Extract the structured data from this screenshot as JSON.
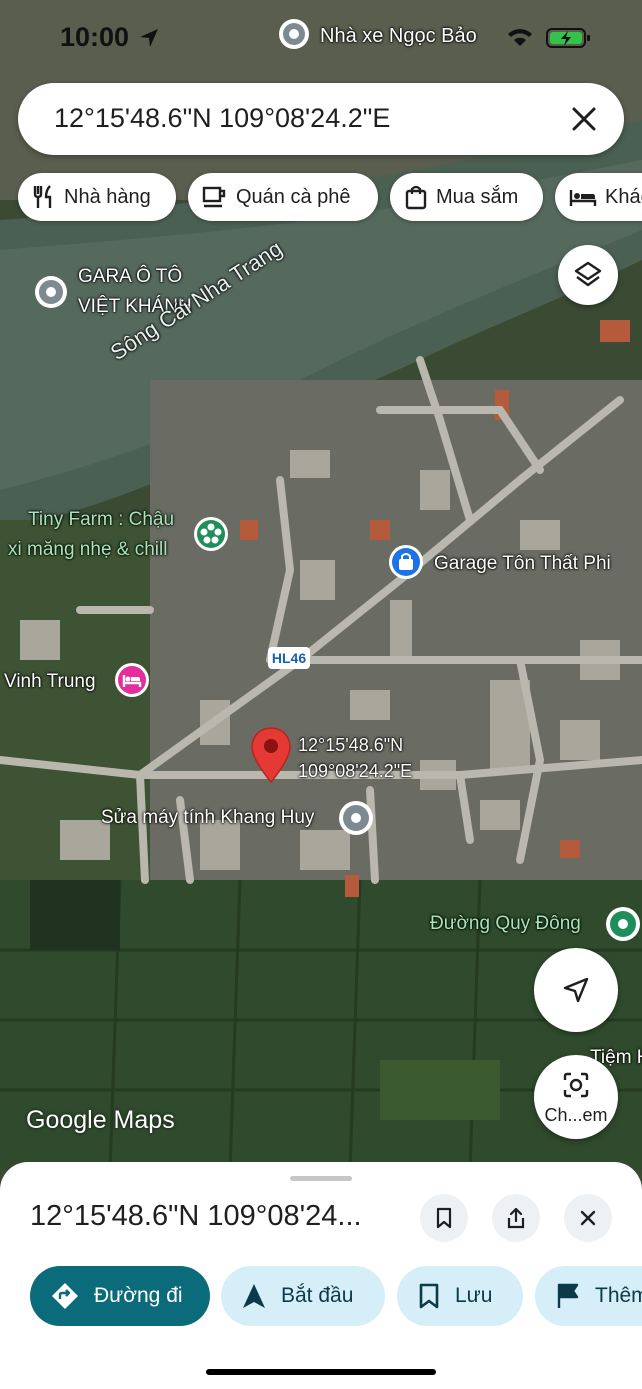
{
  "status": {
    "time": "10:00"
  },
  "search": {
    "query": "12°15'48.6\"N 109°08'24.2\"E"
  },
  "chips": [
    {
      "label": "Nhà hàng",
      "icon": "restaurant-icon"
    },
    {
      "label": "Quán cà phê",
      "icon": "cafe-icon"
    },
    {
      "label": "Mua sắm",
      "icon": "shopping-icon"
    },
    {
      "label": "Khác",
      "icon": "hotel-icon"
    }
  ],
  "map": {
    "river_label": "Sông Cái Nha Trang",
    "road_shield": "HL46",
    "pins": {
      "top": "Nhà xe Ngọc Bảo",
      "gara": [
        "GARA Ô TÔ",
        "VIỆT KHÁNH"
      ],
      "tiny_farm": [
        "Tiny Farm : Chậu",
        "xi măng nhẹ & chill"
      ],
      "garage": "Garage Tôn Thất Phi",
      "vinh_trung": "Vinh Trung",
      "coord_line1": "12°15'48.6\"N",
      "coord_line2": "109°08'24.2\"E",
      "sua_may": "Sửa máy tính Khang Huy",
      "duong_quy_dong": "Đường Quy Đông",
      "tiem": "Tiệm H"
    },
    "attribution": "Google Maps",
    "lens_label": "Ch...em"
  },
  "sheet": {
    "title": "12°15'48.6\"N 109°08'24...",
    "actions": [
      {
        "label": "Đường đi"
      },
      {
        "label": "Bắt đầu"
      },
      {
        "label": "Lưu"
      },
      {
        "label": "Thêm"
      }
    ]
  },
  "colors": {
    "primary": "#0b6b7a",
    "secondary": "#d6eef8",
    "pin_red": "#e53935"
  }
}
